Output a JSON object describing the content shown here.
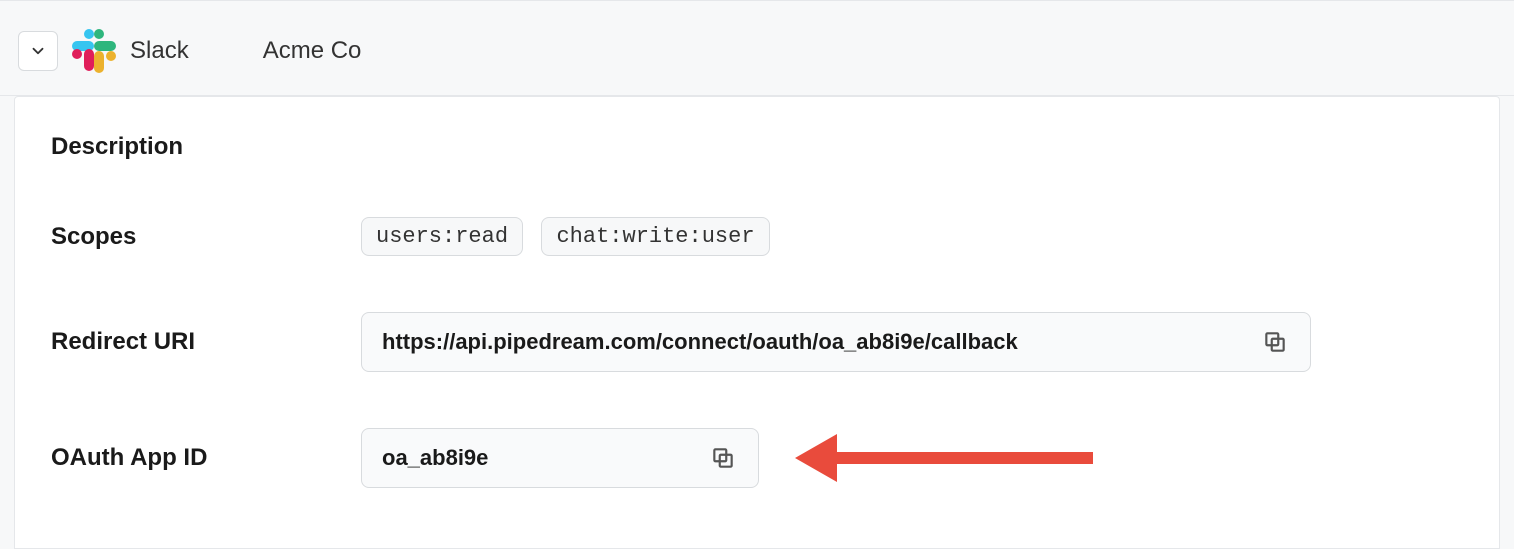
{
  "header": {
    "app_name": "Slack",
    "org_name": "Acme Co"
  },
  "fields": {
    "description_label": "Description",
    "scopes_label": "Scopes",
    "redirect_uri_label": "Redirect URI",
    "oauth_app_id_label": "OAuth App ID"
  },
  "scopes": [
    "users:read",
    "chat:write:user"
  ],
  "redirect_uri": "https://api.pipedream.com/connect/oauth/oa_ab8i9e/callback",
  "oauth_app_id": "oa_ab8i9e"
}
